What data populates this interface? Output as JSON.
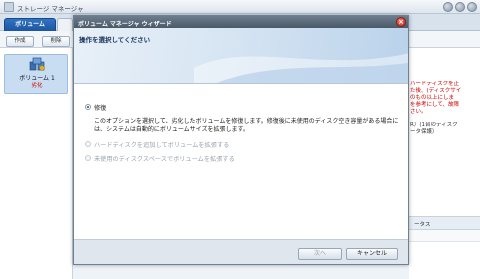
{
  "app": {
    "title": "ストレージ マネージャ",
    "tabs": [
      "ボリューム"
    ],
    "toolbar": {
      "create_label": "作成",
      "delete_label": "削除"
    }
  },
  "volume_list": [
    {
      "name": "ボリューム 1",
      "status": "劣化"
    }
  ],
  "side_panel": {
    "warning_text": "ハードディスクを正\nた後、(ディスクサイ\nのもの以上にしま\nを参考にして、故障\nさい。",
    "info_text": "R）(1台のディスク\nータ保護）",
    "status_label": "ータス"
  },
  "dialog": {
    "title": "ボリューム マネージャ ウィザード",
    "header": "操作を選択してください",
    "options": [
      {
        "label": "修復",
        "selected": true,
        "enabled": true,
        "description": "このオプションを選択して、劣化したボリュームを修復します。修復後に未使用のディスク空き容量がある場合には、システムは自動的にボリュームサイズを拡張します。"
      },
      {
        "label": "ハードディスクを追加してボリュームを拡張する",
        "selected": false,
        "enabled": false
      },
      {
        "label": "未使用のディスクスペースでボリュームを拡張する",
        "selected": false,
        "enabled": false
      }
    ],
    "buttons": {
      "next": "次へ",
      "cancel": "キャンセル"
    }
  },
  "colors": {
    "accent": "#1d55a0",
    "error": "#d00000"
  }
}
